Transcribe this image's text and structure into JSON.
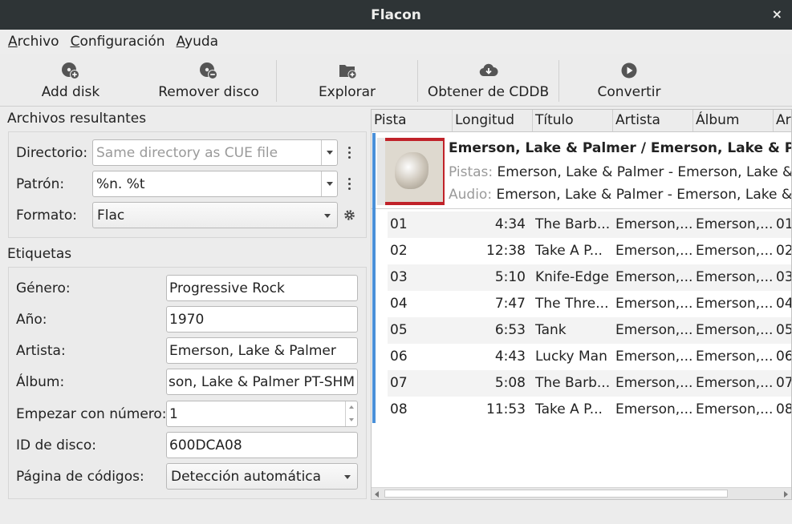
{
  "window": {
    "title": "Flacon",
    "close_glyph": "×"
  },
  "menu": [
    "Archivo",
    "Configuración",
    "Ayuda"
  ],
  "toolbar": {
    "add_disk": "Add disk",
    "remove_disk": "Remover disco",
    "browse": "Explorar",
    "cddb": "Obtener de CDDB",
    "convert": "Convertir"
  },
  "output": {
    "section": "Archivos resultantes",
    "directory_label": "Directorio:",
    "directory_placeholder": "Same directory as CUE file",
    "pattern_label": "Patrón:",
    "pattern_value": "%n. %t",
    "format_label": "Formato:",
    "format_value": "Flac"
  },
  "tags": {
    "section": "Etiquetas",
    "genre_label": "Género:",
    "genre_value": "Progressive Rock",
    "year_label": "Año:",
    "year_value": "1970",
    "artist_label": "Artista:",
    "artist_value": "Emerson, Lake & Palmer",
    "album_label": "Álbum:",
    "album_value": "son, Lake & Palmer PT-SHM",
    "start_label": "Empezar con número:",
    "start_value": "1",
    "discid_label": "ID de disco:",
    "discid_value": "600DCA08",
    "codepage_label": "Página de códigos:",
    "codepage_value": "Detección automática"
  },
  "tracklist": {
    "columns": [
      "Pista",
      "Longitud",
      "Título",
      "Artista",
      "Álbum",
      "Arc"
    ],
    "disk": {
      "title": "Emerson, Lake & Palmer / Emerson, Lake & Pal",
      "tracks_key": "Pistas:",
      "tracks_value": "Emerson, Lake & Palmer - Emerson, Lake & F",
      "audio_key": "Audio:",
      "audio_value": "Emerson, Lake & Palmer - Emerson, Lake & F"
    },
    "rows": [
      {
        "num": "01",
        "len": "4:34",
        "title": "The Barb...",
        "artist": "Emerson,...",
        "album": "Emerson,...",
        "extra": "01"
      },
      {
        "num": "02",
        "len": "12:38",
        "title": "Take A P...",
        "artist": "Emerson,...",
        "album": "Emerson,...",
        "extra": "02"
      },
      {
        "num": "03",
        "len": "5:10",
        "title": "Knife-Edge",
        "artist": "Emerson,...",
        "album": "Emerson,...",
        "extra": "03"
      },
      {
        "num": "04",
        "len": "7:47",
        "title": "The Thre...",
        "artist": "Emerson,...",
        "album": "Emerson,...",
        "extra": "04"
      },
      {
        "num": "05",
        "len": "6:53",
        "title": "Tank",
        "artist": "Emerson,...",
        "album": "Emerson,...",
        "extra": "05"
      },
      {
        "num": "06",
        "len": "4:43",
        "title": "Lucky Man",
        "artist": "Emerson,...",
        "album": "Emerson,...",
        "extra": "06"
      },
      {
        "num": "07",
        "len": "5:08",
        "title": "The Barb...",
        "artist": "Emerson,...",
        "album": "Emerson,...",
        "extra": "07"
      },
      {
        "num": "08",
        "len": "11:53",
        "title": "Take A P...",
        "artist": "Emerson,...",
        "album": "Emerson,...",
        "extra": "08"
      }
    ]
  },
  "colors": {
    "titlebar": "#2e3436",
    "selection_bar": "#4a90d9",
    "alt_row": "#f3f3f3"
  }
}
